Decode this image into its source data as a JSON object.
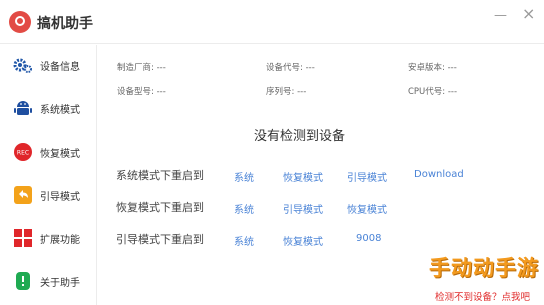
{
  "app": {
    "title": "搞机助手"
  },
  "window": {
    "minimize": "—",
    "close": "×"
  },
  "sidebar": {
    "items": [
      {
        "label": "设备信息",
        "icon": "gear-icon",
        "color": "#1f56a8"
      },
      {
        "label": "系统模式",
        "icon": "android-icon",
        "color": "#1f4fa0"
      },
      {
        "label": "恢复模式",
        "icon": "rec-icon",
        "color": "#e0262a",
        "badge": "REC"
      },
      {
        "label": "引导模式",
        "icon": "back-arrow-icon",
        "color": "#f3a21a"
      },
      {
        "label": "扩展功能",
        "icon": "grid-icon",
        "color": "#e0262a"
      },
      {
        "label": "关于助手",
        "icon": "phone-icon",
        "color": "#1faa52"
      }
    ]
  },
  "device_info": {
    "manufacturer": "制造厂商: ---",
    "device_code": "设备代号: ---",
    "android_version": "安卓版本: ---",
    "device_model": "设备型号: ---",
    "serial": "序列号: ---",
    "cpu_code": "CPU代号: ---"
  },
  "status": {
    "headline": "没有检测到设备"
  },
  "reboot_rows": [
    {
      "label": "系统模式下重启到",
      "options": [
        "系统",
        "恢复模式",
        "引导模式",
        "Download"
      ]
    },
    {
      "label": "恢复模式下重启到",
      "options": [
        "系统",
        "引导模式",
        "恢复模式"
      ]
    },
    {
      "label": "引导模式下重启到",
      "options": [
        "系统",
        "恢复模式",
        "9008"
      ]
    }
  ],
  "footer": {
    "help_link": "检测不到设备？点我吧",
    "watermark": "手动动手游"
  }
}
